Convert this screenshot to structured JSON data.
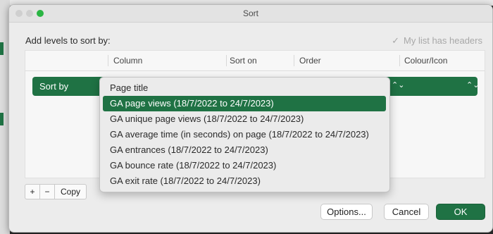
{
  "window": {
    "title": "Sort"
  },
  "header": {
    "add_levels_label": "Add levels to sort by:",
    "headers_checkbox_label": "My list has headers",
    "headers_checkbox_checked": true,
    "headers_checkbox_glyph": "✓"
  },
  "columns": [
    "Column",
    "Sort on",
    "Order",
    "Colour/Icon"
  ],
  "sort_row": {
    "label": "Sort by",
    "updown_glyph": "⌃⌄"
  },
  "dropdown": {
    "items": [
      "Page title",
      "GA page views (18/7/2022 to 24/7/2023)",
      "GA unique page views (18/7/2022 to 24/7/2023)",
      "GA average time (in seconds) on page (18/7/2022 to 24/7/2023)",
      "GA entrances  (18/7/2022 to 24/7/2023)",
      "GA bounce rate (18/7/2022 to 24/7/2023)",
      "GA exit rate (18/7/2022 to 24/7/2023)"
    ],
    "selected_index": 1
  },
  "controls": {
    "add": "+",
    "remove": "−",
    "copy": "Copy"
  },
  "buttons": {
    "options": "Options...",
    "cancel": "Cancel",
    "ok": "OK"
  },
  "colors": {
    "accent": "#1f7244",
    "traffic_green": "#2ab543"
  }
}
